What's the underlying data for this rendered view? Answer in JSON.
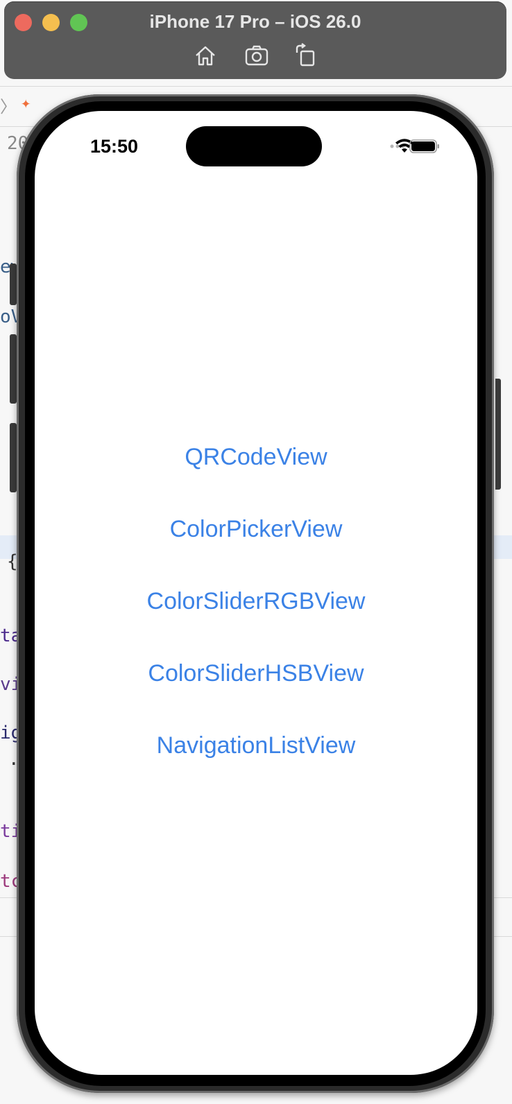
{
  "window": {
    "title": "iPhone 17 Pro – iOS 26.0",
    "toolbar": [
      {
        "icon": "home-icon"
      },
      {
        "icon": "screenshot-icon"
      },
      {
        "icon": "rotate-icon"
      }
    ]
  },
  "background_editor": {
    "visible_fragments": [
      "20",
      "ew",
      "oV",
      "{",
      "ta",
      "vi",
      "ig",
      ".",
      "ti",
      "tc"
    ]
  },
  "status_bar": {
    "time": "15:50"
  },
  "links": [
    {
      "label": "QRCodeView"
    },
    {
      "label": "ColorPickerView"
    },
    {
      "label": "ColorSliderRGBView"
    },
    {
      "label": "ColorSliderHSBView"
    },
    {
      "label": "NavigationListView"
    }
  ],
  "colors": {
    "link": "#3b82e6",
    "titlebar": "#5a5a5a"
  }
}
